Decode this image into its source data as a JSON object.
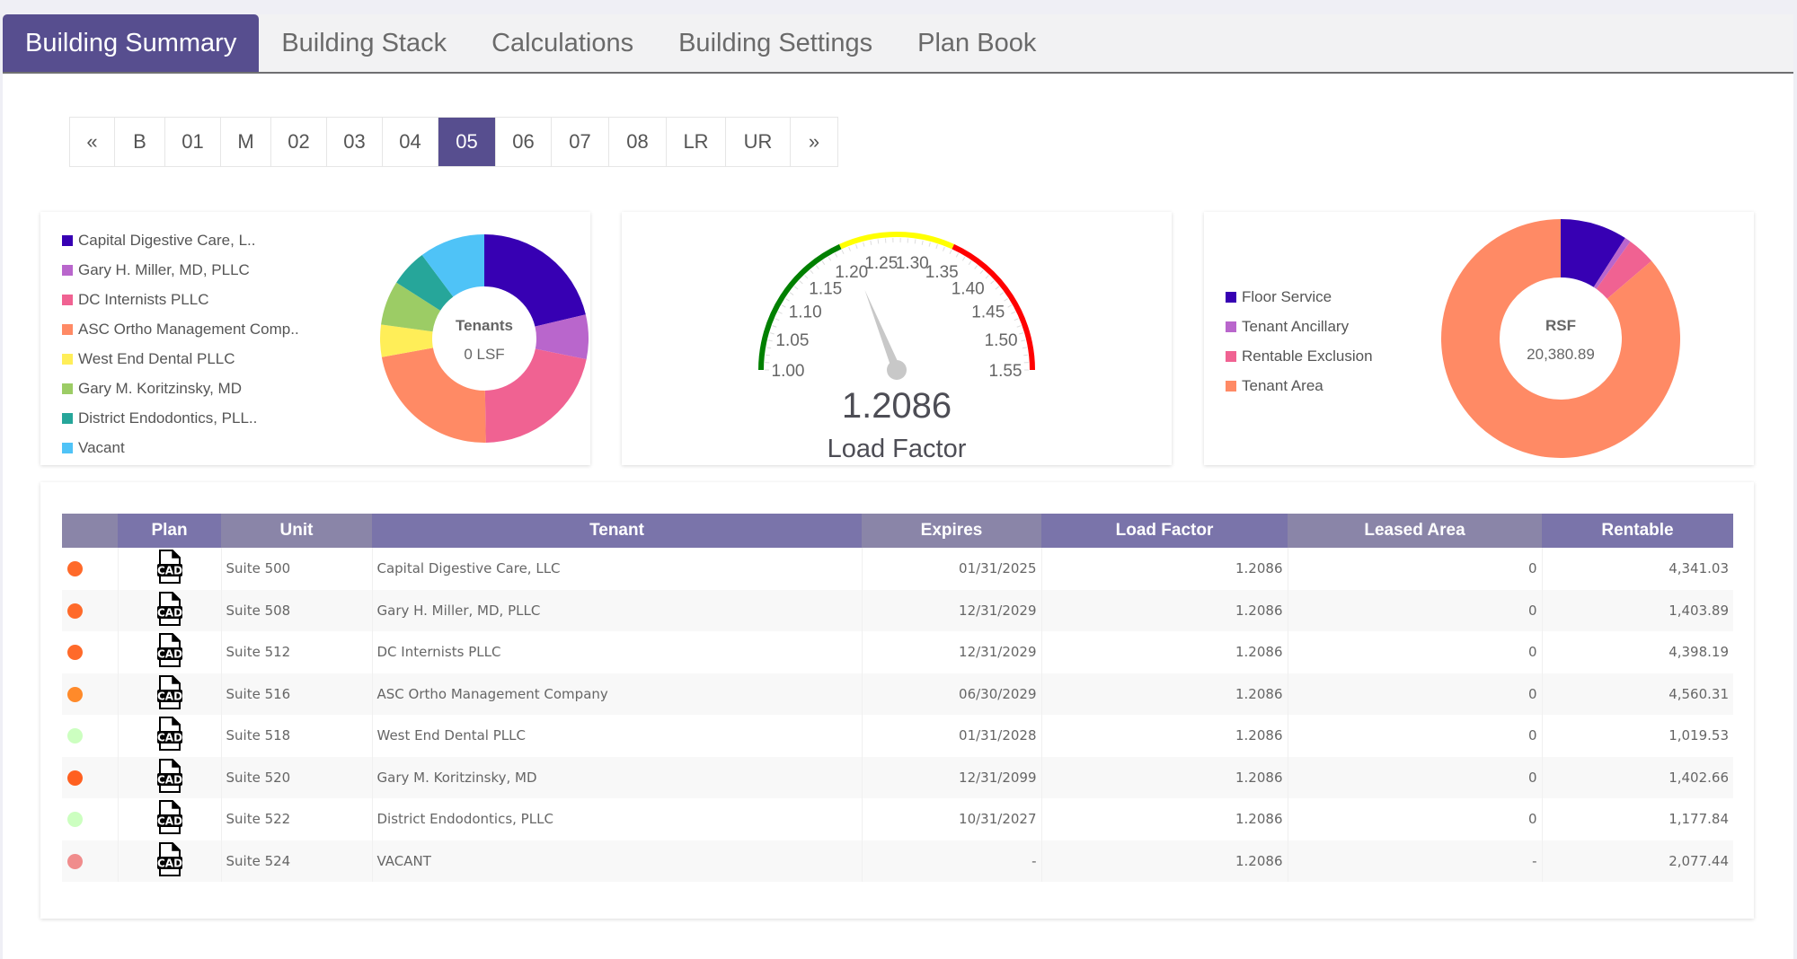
{
  "tabs": [
    {
      "label": "Building Summary",
      "active": true
    },
    {
      "label": "Building Stack",
      "active": false
    },
    {
      "label": "Calculations",
      "active": false
    },
    {
      "label": "Building Settings",
      "active": false
    },
    {
      "label": "Plan Book",
      "active": false
    }
  ],
  "pagination": {
    "items": [
      "«",
      "B",
      "01",
      "M",
      "02",
      "03",
      "04",
      "05",
      "06",
      "07",
      "08",
      "LR",
      "UR",
      "»"
    ],
    "active": "05"
  },
  "tenants_chart": {
    "center_title": "Tenants",
    "center_value": "0 LSF",
    "legend": [
      {
        "label": "Capital Digestive Care, L..",
        "color": "#3700b3"
      },
      {
        "label": "Gary H. Miller, MD, PLLC",
        "color": "#b966cc"
      },
      {
        "label": "DC Internists PLLC",
        "color": "#f06292"
      },
      {
        "label": "ASC Ortho Management Comp..",
        "color": "#ff8a65"
      },
      {
        "label": "West End Dental PLLC",
        "color": "#ffee58"
      },
      {
        "label": "Gary M. Koritzinsky, MD",
        "color": "#9ccc65"
      },
      {
        "label": "District Endodontics, PLL..",
        "color": "#26a69a"
      },
      {
        "label": "Vacant",
        "color": "#4fc3f7"
      }
    ]
  },
  "gauge": {
    "value_text": "1.2086",
    "label": "Load Factor",
    "needle_color": "#c8c8c8"
  },
  "rsf_chart": {
    "center_title": "RSF",
    "center_value": "20,380.89",
    "legend": [
      {
        "label": "Floor Service",
        "color": "#3700b3"
      },
      {
        "label": "Tenant Ancillary",
        "color": "#b966cc"
      },
      {
        "label": "Rentable Exclusion",
        "color": "#f06292"
      },
      {
        "label": "Tenant Area",
        "color": "#ff8a65"
      }
    ]
  },
  "chart_data": [
    {
      "type": "pie",
      "title": "Tenants",
      "subtitle": "0 LSF",
      "categories": [
        "Capital Digestive Care, LLC",
        "Gary H. Miller, MD, PLLC",
        "DC Internists PLLC",
        "ASC Ortho Management Company",
        "West End Dental PLLC",
        "Gary M. Koritzinsky, MD",
        "District Endodontics, PLLC",
        "Vacant"
      ],
      "values": [
        4341.03,
        1403.89,
        4398.19,
        4560.31,
        1019.53,
        1402.66,
        1177.84,
        2077.44
      ],
      "colors": [
        "#3700b3",
        "#b966cc",
        "#f06292",
        "#ff8a65",
        "#ffee58",
        "#9ccc65",
        "#26a69a",
        "#4fc3f7"
      ],
      "legend": "left",
      "donut": true
    },
    {
      "type": "gauge",
      "title": "Load Factor",
      "value": 1.2086,
      "range": [
        1.0,
        1.55
      ],
      "ticks": [
        "1.00",
        "1.05",
        "1.10",
        "1.15",
        "1.20",
        "1.25",
        "1.30",
        "1.35",
        "1.40",
        "1.45",
        "1.50",
        "1.55"
      ],
      "bands": [
        {
          "from": 1.0,
          "to": 1.2,
          "color": "#008000"
        },
        {
          "from": 1.2,
          "to": 1.35,
          "color": "#ffff00"
        },
        {
          "from": 1.35,
          "to": 1.55,
          "color": "#ff0000"
        }
      ]
    },
    {
      "type": "pie",
      "title": "RSF",
      "subtitle": "20,380.89",
      "categories": [
        "Floor Service",
        "Tenant Ancillary",
        "Rentable Exclusion",
        "Tenant Area"
      ],
      "values": [
        1850,
        170,
        780,
        17580.89
      ],
      "colors": [
        "#3700b3",
        "#b966cc",
        "#f06292",
        "#ff8a65"
      ],
      "legend": "left",
      "donut": true
    }
  ],
  "table": {
    "columns": [
      "",
      "Plan",
      "Unit",
      "Tenant",
      "Expires",
      "Load Factor",
      "Leased Area",
      "Rentable"
    ],
    "plan_icon_label": "CAD",
    "rows": [
      {
        "status_color": "#ff6a2a",
        "unit": "Suite 500",
        "tenant": "Capital Digestive Care, LLC",
        "expires": "01/31/2025",
        "load_factor": "1.2086",
        "leased_area": "0",
        "rentable": "4,341.03"
      },
      {
        "status_color": "#ff6a2a",
        "unit": "Suite 508",
        "tenant": "Gary H. Miller, MD, PLLC",
        "expires": "12/31/2029",
        "load_factor": "1.2086",
        "leased_area": "0",
        "rentable": "1,403.89"
      },
      {
        "status_color": "#ff6a2a",
        "unit": "Suite 512",
        "tenant": "DC Internists PLLC",
        "expires": "12/31/2029",
        "load_factor": "1.2086",
        "leased_area": "0",
        "rentable": "4,398.19"
      },
      {
        "status_color": "#ff8a2a",
        "unit": "Suite 516",
        "tenant": "ASC Ortho Management Company",
        "expires": "06/30/2029",
        "load_factor": "1.2086",
        "leased_area": "0",
        "rentable": "4,560.31"
      },
      {
        "status_color": "#ccffc0",
        "unit": "Suite 518",
        "tenant": "West End Dental PLLC",
        "expires": "01/31/2028",
        "load_factor": "1.2086",
        "leased_area": "0",
        "rentable": "1,019.53"
      },
      {
        "status_color": "#ff6020",
        "unit": "Suite 520",
        "tenant": "Gary M. Koritzinsky, MD",
        "expires": "12/31/2099",
        "load_factor": "1.2086",
        "leased_area": "0",
        "rentable": "1,402.66"
      },
      {
        "status_color": "#ccffc0",
        "unit": "Suite 522",
        "tenant": "District Endodontics, PLLC",
        "expires": "10/31/2027",
        "load_factor": "1.2086",
        "leased_area": "0",
        "rentable": "1,177.84"
      },
      {
        "status_color": "#f08c8c",
        "unit": "Suite 524",
        "tenant": "VACANT",
        "expires": "-",
        "load_factor": "1.2086",
        "leased_area": "-",
        "rentable": "2,077.44"
      }
    ]
  }
}
